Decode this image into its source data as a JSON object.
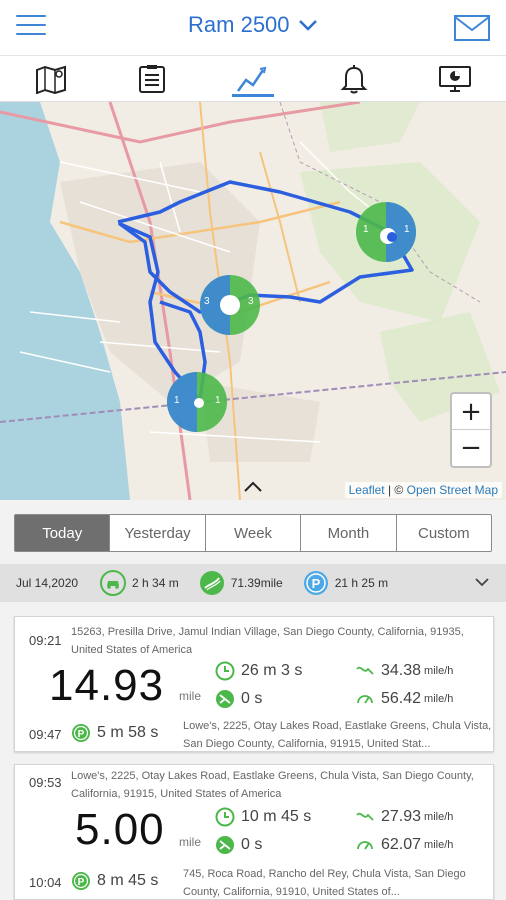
{
  "header": {
    "title": "Ram 2500"
  },
  "tabs": [
    {
      "icon": "map-icon"
    },
    {
      "icon": "list-icon"
    },
    {
      "icon": "chart-line-icon",
      "active": true
    },
    {
      "icon": "bell-icon"
    },
    {
      "icon": "monitor-icon"
    }
  ],
  "map": {
    "attribution_leaflet": "Leaflet",
    "attribution_sep": " | © ",
    "attribution_osm": "Open Street Map",
    "zoom_in": "+",
    "zoom_out": "−",
    "clusters": [
      {
        "left": "1",
        "right": "1"
      },
      {
        "left": "3",
        "right": "3"
      },
      {
        "left": "1",
        "right": "1"
      }
    ]
  },
  "periods": [
    "Today",
    "Yesterday",
    "Week",
    "Month",
    "Custom"
  ],
  "active_period": "Today",
  "summary": {
    "date": "Jul 14,2020",
    "drive_time": "2 h 34 m",
    "distance": "71.39mile",
    "park_time": "21 h 25 m"
  },
  "trips": [
    {
      "start_time": "09:21",
      "start_address": "15263, Presilla Drive, Jamul Indian Village, San Diego County, California, 91935, United States of America",
      "distance": "14.93",
      "unit": "mile",
      "duration": "26 m 3 s",
      "idle": "0 s",
      "avg_speed": "34.38",
      "max_speed": "56.42",
      "speed_unit": "mile/h",
      "end_time": "09:47",
      "park": "5 m 58 s",
      "end_address": "Lowe's, 2225, Otay Lakes Road, Eastlake Greens, Chula Vista, San Diego County, California, 91915, United Stat..."
    },
    {
      "start_time": "09:53",
      "start_address": "Lowe's, 2225, Otay Lakes Road, Eastlake Greens, Chula Vista, San Diego County, California, 91915, United States of America",
      "distance": "5.00",
      "unit": "mile",
      "duration": "10 m 45 s",
      "idle": "0 s",
      "avg_speed": "27.93",
      "max_speed": "62.07",
      "speed_unit": "mile/h",
      "end_time": "10:04",
      "park": "8 m 45 s",
      "end_address": "745, Roca Road, Rancho del Rey, Chula Vista, San Diego County, California, 91910, United States of..."
    }
  ],
  "colors": {
    "accent": "#3d86d8",
    "route": "#2b5fe0",
    "green": "#4cb84a",
    "park_badge": "#4ca8e6"
  }
}
